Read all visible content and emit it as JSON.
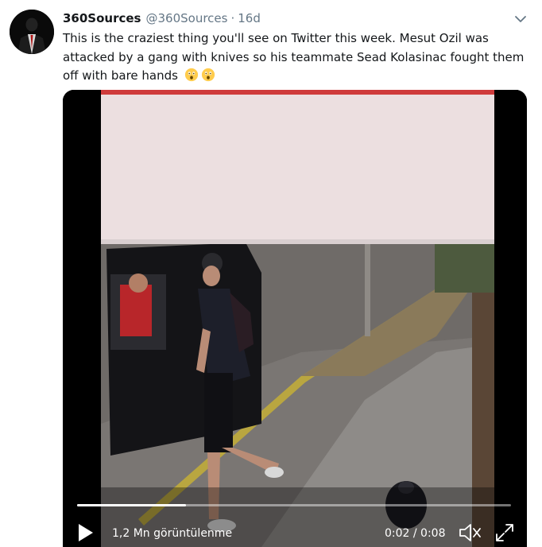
{
  "tweet": {
    "display_name": "360Sources",
    "handle": "@360Sources",
    "separator": "·",
    "time": "16d",
    "text": "This is the craziest thing you'll see on Twitter this week. Mesut Ozil was attacked by a gang with knives so his teammate Sead Kolasinac fought them off with bare hands"
  },
  "video": {
    "views": "1,2 Mn görüntülenme",
    "time_display": "0:02 / 0:08",
    "progress_fraction": 0.25
  },
  "icons": {
    "caret": "chevron-down-icon",
    "play": "play-icon",
    "volume": "volume-icon",
    "fullscreen": "fullscreen-icon",
    "emoji": "astonished-face-emoji"
  },
  "colors": {
    "text": "#14171a",
    "muted": "#657786"
  }
}
